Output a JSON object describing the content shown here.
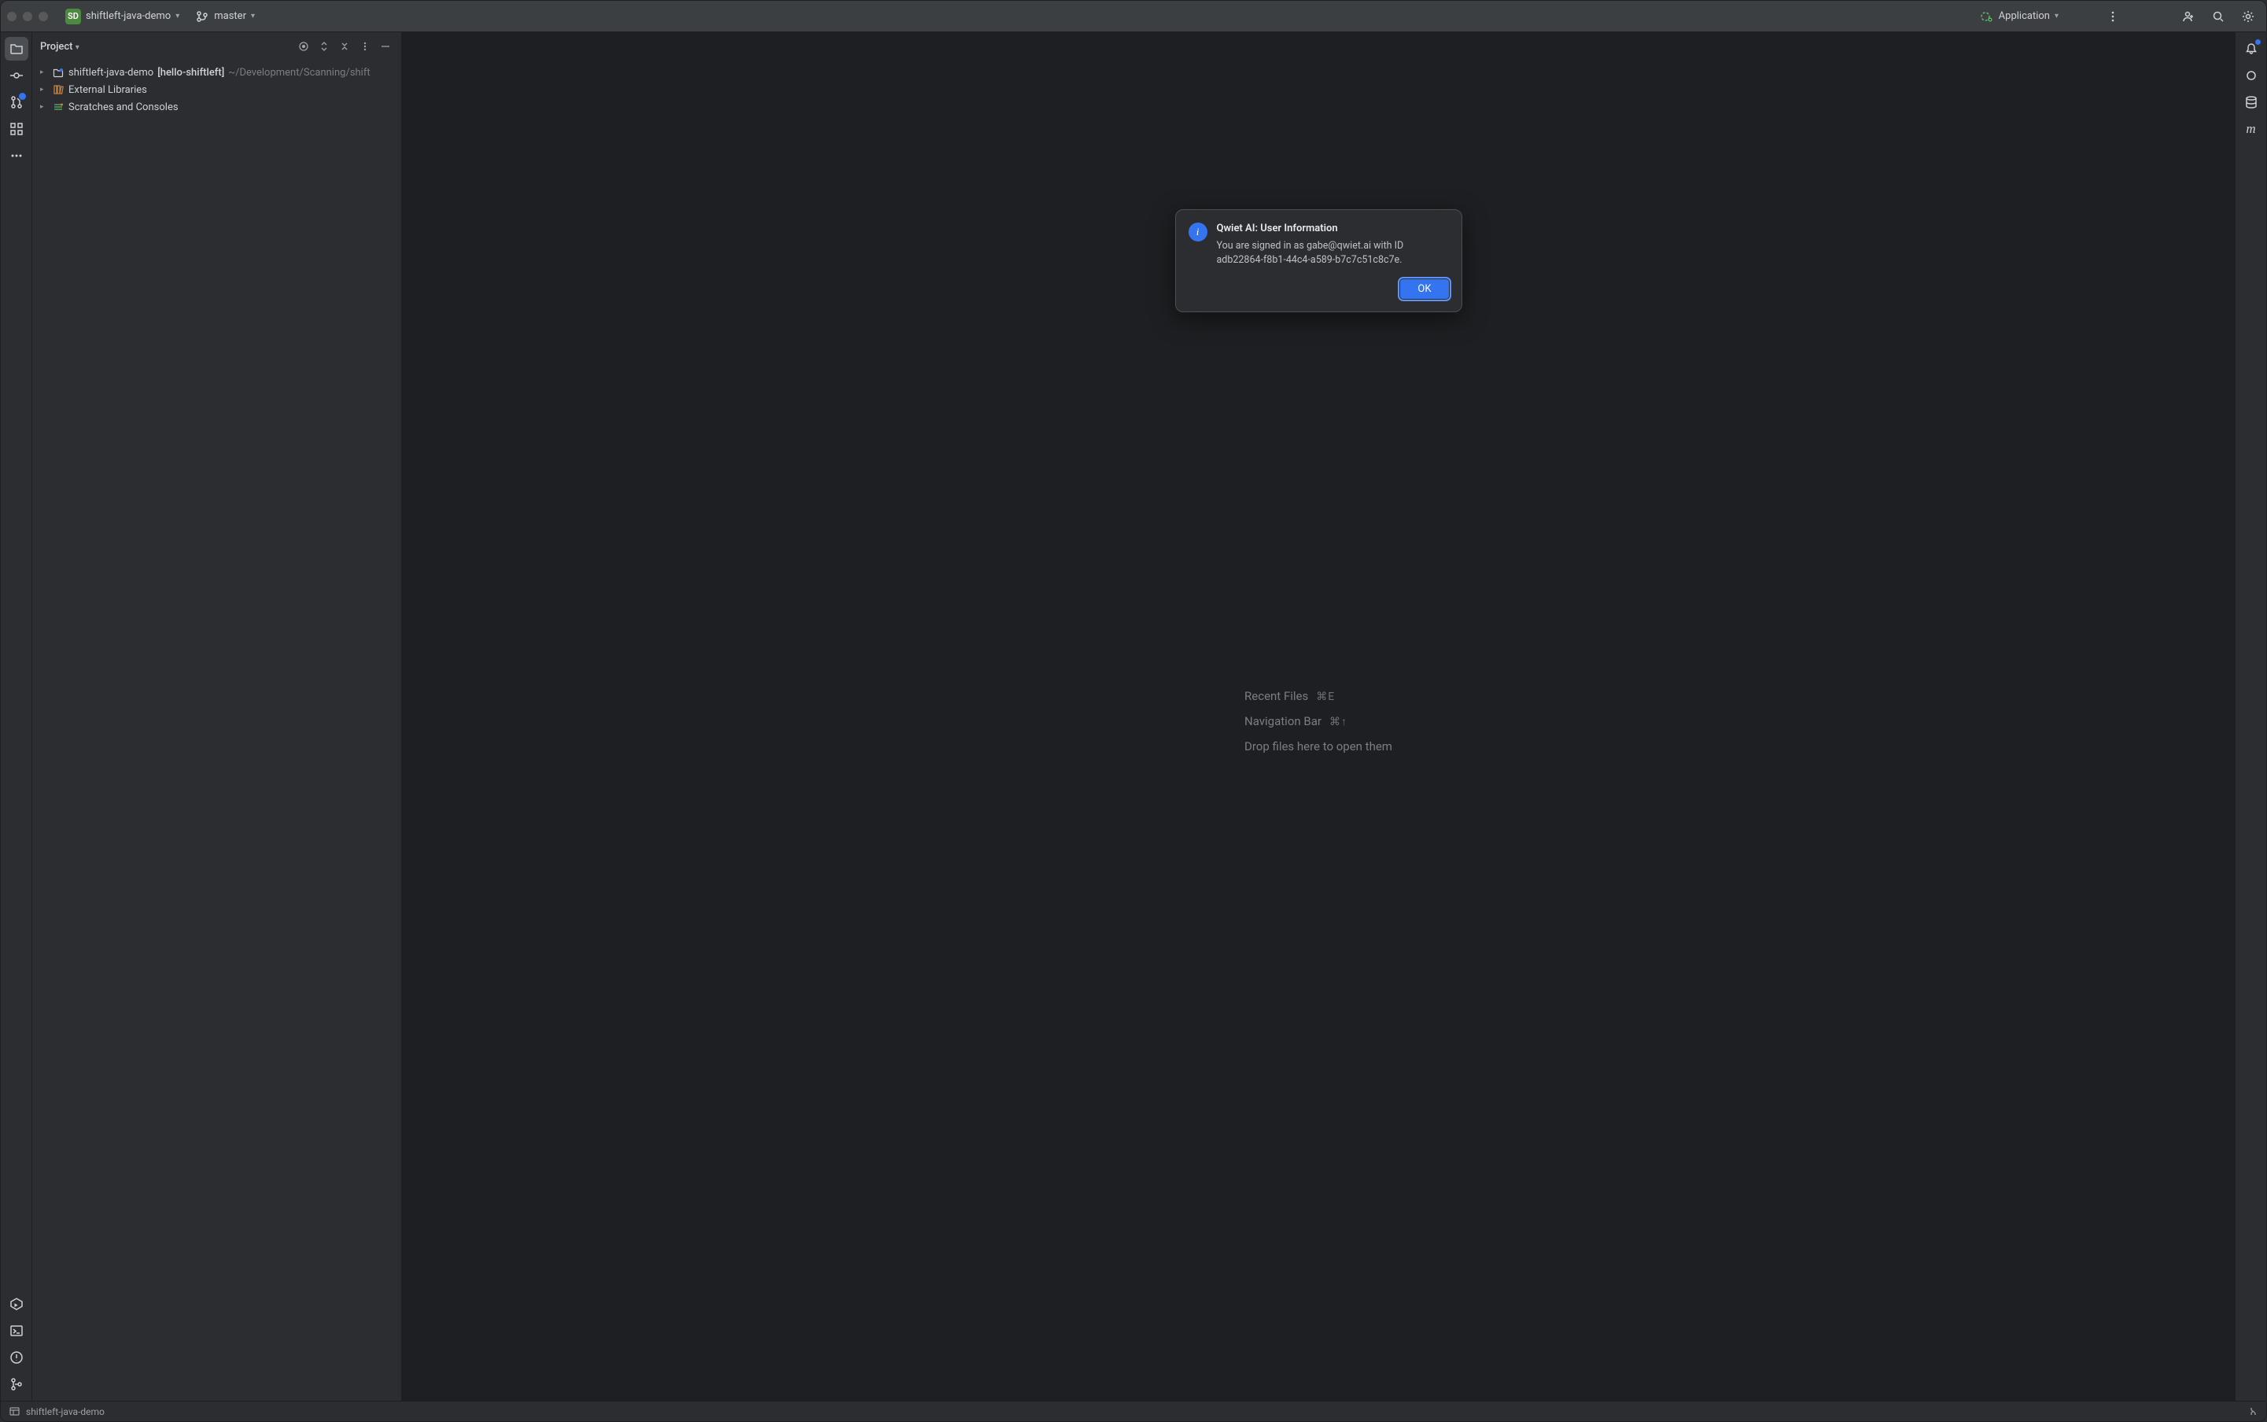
{
  "titlebar": {
    "project_badge": "SD",
    "project_name": "shiftleft-java-demo",
    "branch": "master",
    "run_config": "Application"
  },
  "project_panel": {
    "title": "Project",
    "tree": {
      "root_name": "shiftleft-java-demo",
      "root_tag": "[hello-shiftleft]",
      "root_path": "~/Development/Scanning/shift",
      "external_libs": "External Libraries",
      "scratches": "Scratches and Consoles"
    }
  },
  "editor_hints": {
    "recent_files_label": "Recent Files",
    "recent_files_shortcut": "⌘E",
    "nav_bar_label": "Navigation Bar",
    "nav_bar_shortcut": "⌘↑",
    "drop_hint": "Drop files here to open them"
  },
  "dialog": {
    "title": "Qwiet AI: User Information",
    "message": "You are signed in as gabe@qwiet.ai with ID adb22864-f8b1-44c4-a589-b7c7c51c8c7e.",
    "ok_label": "OK",
    "icon_glyph": "i"
  },
  "statusbar": {
    "module": "shiftleft-java-demo"
  },
  "left_tools": {
    "pull_requests_badge": "●"
  }
}
